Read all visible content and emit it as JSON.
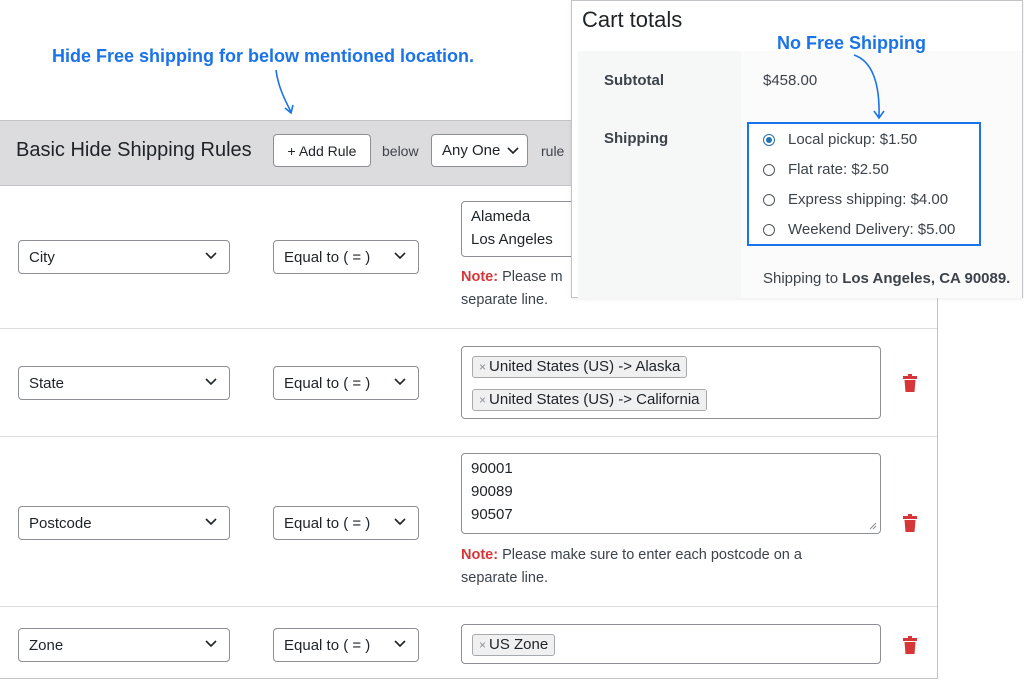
{
  "annotations": {
    "hide_free_shipping": "Hide Free shipping for below mentioned location.",
    "no_free_shipping": "No Free Shipping"
  },
  "rules_header": {
    "title": "Basic Hide Shipping Rules",
    "add_rule_label": "+ Add Rule",
    "below_text": "below",
    "match_select_value": "Any One",
    "rule_text": "rule"
  },
  "rules": [
    {
      "field": "City",
      "operator": "Equal to ( = )",
      "lines": [
        "Alameda",
        "Los Angeles"
      ],
      "note_label": "Note:",
      "note_text_line1": "Please m",
      "note_text_line2": "separate line."
    },
    {
      "field": "State",
      "operator": "Equal to ( = )",
      "chips": [
        "United States (US) -> Alaska",
        "United States (US) -> California"
      ],
      "chip_remove_symbol": "×"
    },
    {
      "field": "Postcode",
      "operator": "Equal to ( = )",
      "lines": [
        "90001",
        "90089",
        "90507"
      ],
      "note_label": "Note:",
      "note_text_line1": "Please make sure to enter each postcode on a",
      "note_text_line2": "separate line."
    },
    {
      "field": "Zone",
      "operator": "Equal to ( = )",
      "chips": [
        "US Zone"
      ],
      "chip_remove_symbol": "×"
    }
  ],
  "cart": {
    "title": "Cart totals",
    "subtotal_label": "Subtotal",
    "subtotal_value": "$458.00",
    "shipping_label": "Shipping",
    "shipping_options": [
      {
        "label": "Local pickup: $1.50",
        "selected": true
      },
      {
        "label": "Flat rate: $2.50",
        "selected": false
      },
      {
        "label": "Express shipping: $4.00",
        "selected": false
      },
      {
        "label": "Weekend Delivery: $5.00",
        "selected": false
      }
    ],
    "shipping_to_prefix": "Shipping to",
    "shipping_to_location": "Los Angeles, CA 90089."
  },
  "colors": {
    "annotation_blue": "#1a73e8",
    "note_red": "#d63638",
    "trash_red": "#d63638",
    "header_gray": "#dcdcde"
  },
  "icons": {
    "select_arrow": "chevron-down-icon",
    "delete": "trash-icon",
    "resize": "resize-handle-icon"
  }
}
